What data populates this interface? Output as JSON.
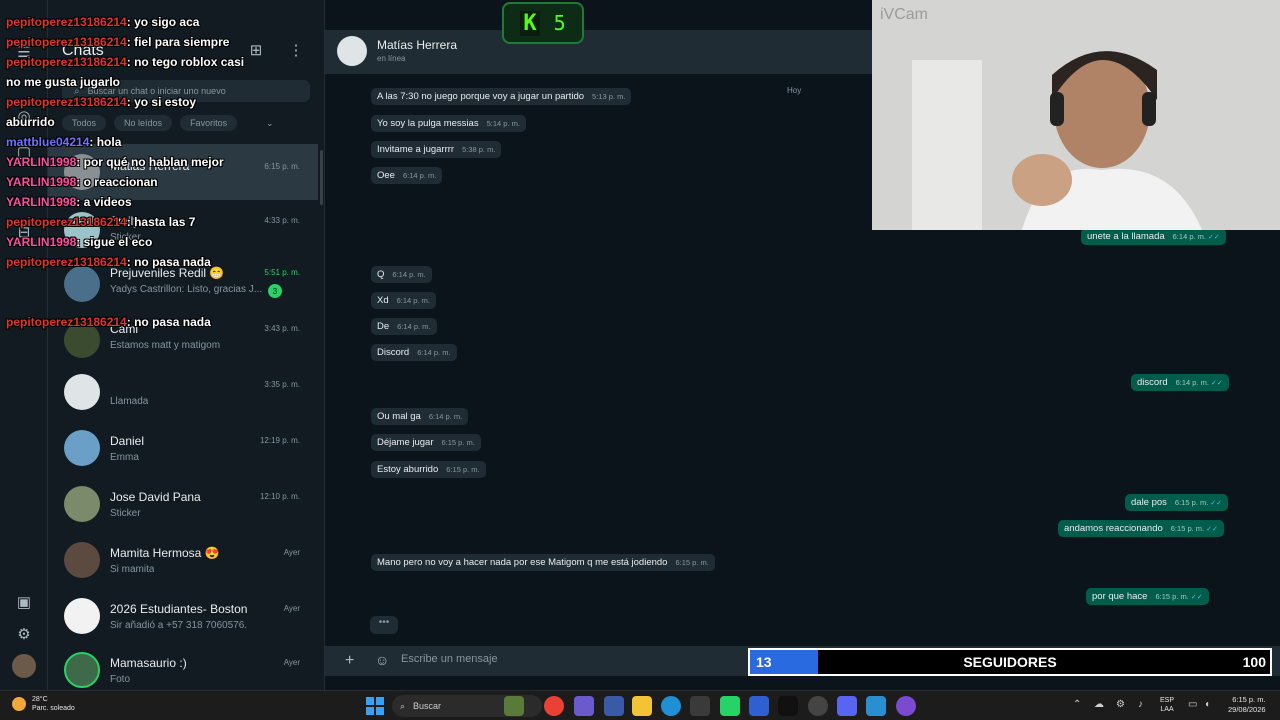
{
  "app": {
    "title": "WhatsApp"
  },
  "sidebar": {
    "heading": "Chats",
    "search_placeholder": "Buscar un chat o iniciar uno nuevo",
    "filters": [
      "Todos",
      "No leídos",
      "Favoritos"
    ],
    "chats": [
      {
        "name": "Matias Herrera",
        "preview": "",
        "time": "6:15 p. m.",
        "active": true
      },
      {
        "name": "Emily",
        "preview": "Sticker",
        "time": "4:33 p. m."
      },
      {
        "name": "Prejuveniles Redil 😁",
        "preview": "Yadys Castrillon: Listo, gracias J...",
        "time": "5:51 p. m.",
        "unread": "3",
        "green": true
      },
      {
        "name": "Cami",
        "preview": "Estamos matt y matigom",
        "time": "3:43 p. m."
      },
      {
        "name": "Matt",
        "preview": "Llamada",
        "time": "3:35 p. m."
      },
      {
        "name": "Daniel",
        "preview": "Emma",
        "time": "12:19 p. m."
      },
      {
        "name": "Jose David Pana",
        "preview": "Sticker",
        "time": "12:10 p. m."
      },
      {
        "name": "Mamita Hermosa 😍",
        "preview": "Si mamita",
        "time": "Ayer"
      },
      {
        "name": "2026 Estudiantes- Boston",
        "preview": "Sir añadió a +57 318 7060576.",
        "time": "Ayer"
      },
      {
        "name": "Mamasaurio :)",
        "preview": "Foto",
        "time": "Ayer"
      }
    ]
  },
  "conversation": {
    "contact": "Matías Herrera",
    "status": "en línea",
    "day": "Hoy",
    "composer_placeholder": "Escribe un mensaje",
    "messages": [
      {
        "dir": "in",
        "text": "A las 7:30 no juego porque voy a jugar un partido",
        "time": "5:13 p. m."
      },
      {
        "dir": "in",
        "text": "Yo soy la pulga messias",
        "time": "5:14 p. m."
      },
      {
        "dir": "in",
        "text": "Invitame a jugarrrr",
        "time": "5:38 p. m."
      },
      {
        "dir": "in",
        "text": "Oee",
        "time": "6:14 p. m."
      },
      {
        "dir": "out",
        "text": "unete a la llamada",
        "time": "6:14 p. m."
      },
      {
        "dir": "in",
        "text": "Q",
        "time": "6:14 p. m."
      },
      {
        "dir": "in",
        "text": "Xd",
        "time": "6:14 p. m."
      },
      {
        "dir": "in",
        "text": "De",
        "time": "6:14 p. m."
      },
      {
        "dir": "in",
        "text": "Discord",
        "time": "6:14 p. m."
      },
      {
        "dir": "out",
        "text": "discord",
        "time": "6:14 p. m."
      },
      {
        "dir": "in",
        "text": "Ou mal ga",
        "time": "6:14 p. m."
      },
      {
        "dir": "in",
        "text": "Déjame jugar",
        "time": "6:15 p. m."
      },
      {
        "dir": "in",
        "text": "Estoy aburrido",
        "time": "6:15 p. m."
      },
      {
        "dir": "out",
        "text": "dale pos",
        "time": "6:15 p. m."
      },
      {
        "dir": "out",
        "text": "andamos reaccionando",
        "time": "6:15 p. m."
      },
      {
        "dir": "in",
        "text": "Mano pero no voy a hacer nada por ese Matigom q me está jodiendo",
        "time": "6:15 p. m."
      },
      {
        "dir": "out",
        "text": "por que hace",
        "time": "6:15 p. m."
      }
    ]
  },
  "stream_overlay": {
    "kick_counter": "5",
    "webcam_label": "iVCam",
    "chat": [
      {
        "user": "pepitoperez13186214",
        "text": "yo sigo aca"
      },
      {
        "user": "pepitoperez13186214",
        "text": "fiel para siempre"
      },
      {
        "user": "pepitoperez13186214",
        "text": "no tego roblox casi no me gusta jugarlo"
      },
      {
        "user": "pepitoperez13186214",
        "text": "yo si estoy aburrido"
      },
      {
        "user": "mattblue04214",
        "text": "hola",
        "color": "blue"
      },
      {
        "user": "YARLIN1998",
        "text": "por qué no hablan mejor",
        "color": "pink"
      },
      {
        "user": "YARLIN1998",
        "text": "o reaccionan",
        "color": "pink"
      },
      {
        "user": "YARLIN1998",
        "text": "a videos",
        "color": "pink"
      },
      {
        "user": "pepitoperez13186214",
        "text": "hasta las 7"
      },
      {
        "user": "YARLIN1998",
        "text": "sigue el eco",
        "color": "pink"
      },
      {
        "user": "pepitoperez13186214",
        "text": "no pasa nada"
      },
      {
        "user": "pepitoperez13186214",
        "text": "no pasa nada"
      }
    ],
    "followers": {
      "current": "13",
      "label": "SEGUIDORES",
      "goal": "100",
      "progress": 0.13
    }
  },
  "taskbar": {
    "weather_temp": "28°C",
    "weather_desc": "Parc. soleado",
    "search": "Buscar",
    "lang_top": "ESP",
    "lang_bottom": "LAA",
    "time": "6:15 p. m.",
    "date": "29/08/2026"
  },
  "colors": {
    "accent": "#25d366",
    "outgoing": "#005c4b",
    "incoming": "#202c33",
    "kick": "#53fc18"
  }
}
